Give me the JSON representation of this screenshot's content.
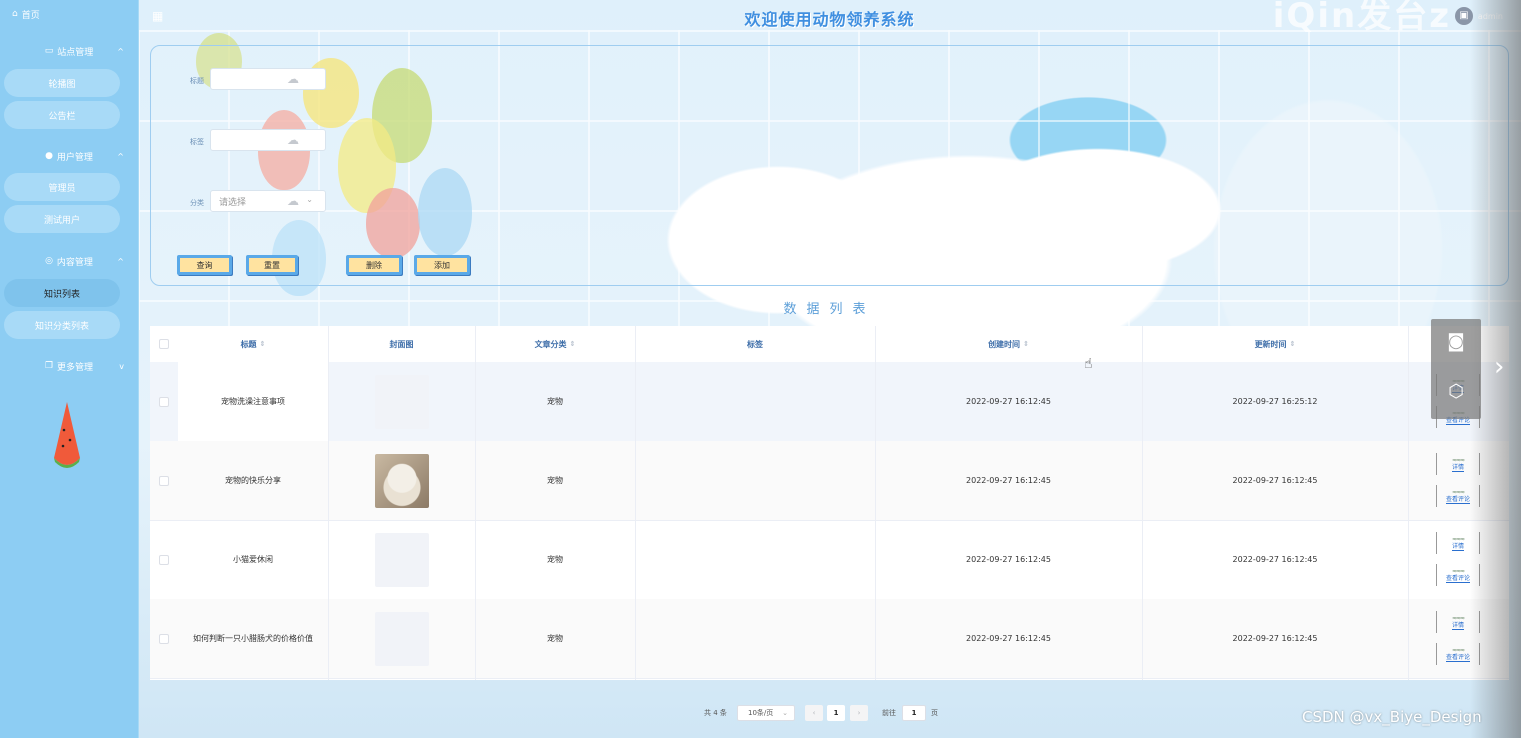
{
  "header": {
    "title": "欢迎使用动物领养系统",
    "deco_text": "iQin发台z",
    "username": "admin"
  },
  "sidebar": {
    "home": "首页",
    "groups": [
      {
        "label": "站点管理",
        "items": [
          "轮播图",
          "公告栏"
        ]
      },
      {
        "label": "用户管理",
        "items": [
          "管理员",
          "测试用户"
        ]
      },
      {
        "label": "内容管理",
        "items": [
          "知识列表",
          "知识分类列表"
        ]
      },
      {
        "label": "更多管理",
        "items": []
      }
    ]
  },
  "search": {
    "title_label": "标题",
    "tag_label": "标签",
    "category_label": "分类",
    "category_placeholder": "请选择",
    "buttons": {
      "query": "查询",
      "reset": "重置",
      "delete": "删除",
      "add": "添加"
    }
  },
  "list_title": "数据列表",
  "table": {
    "headers": {
      "title": "标题",
      "cover": "封面图",
      "category": "文章分类",
      "tags": "标签",
      "created": "创建时间",
      "updated": "更新时间"
    },
    "rows": [
      {
        "title": "宠物洗澡注意事项",
        "category": "宠物",
        "tags": "",
        "created": "2022-09-27 16:12:45",
        "updated": "2022-09-27 16:25:12",
        "has_photo": false
      },
      {
        "title": "宠物的快乐分享",
        "category": "宠物",
        "tags": "",
        "created": "2022-09-27 16:12:45",
        "updated": "2022-09-27 16:12:45",
        "has_photo": true
      },
      {
        "title": "小猫爱休闲",
        "category": "宠物",
        "tags": "",
        "created": "2022-09-27 16:12:45",
        "updated": "2022-09-27 16:12:45",
        "has_photo": false
      },
      {
        "title": "如何判断一只小腊肠犬的价格价值",
        "category": "宠物",
        "tags": "",
        "created": "2022-09-27 16:12:45",
        "updated": "2022-09-27 16:12:45",
        "has_photo": false
      }
    ],
    "ops": {
      "detail": "详情",
      "comments": "查看评论"
    }
  },
  "pagination": {
    "total": "共 4 条",
    "page_size": "10条/页",
    "current_page": "1",
    "goto": "前往",
    "goto_value": "1",
    "unit": "页"
  },
  "watermark": "CSDN @vx_Biye_Design"
}
